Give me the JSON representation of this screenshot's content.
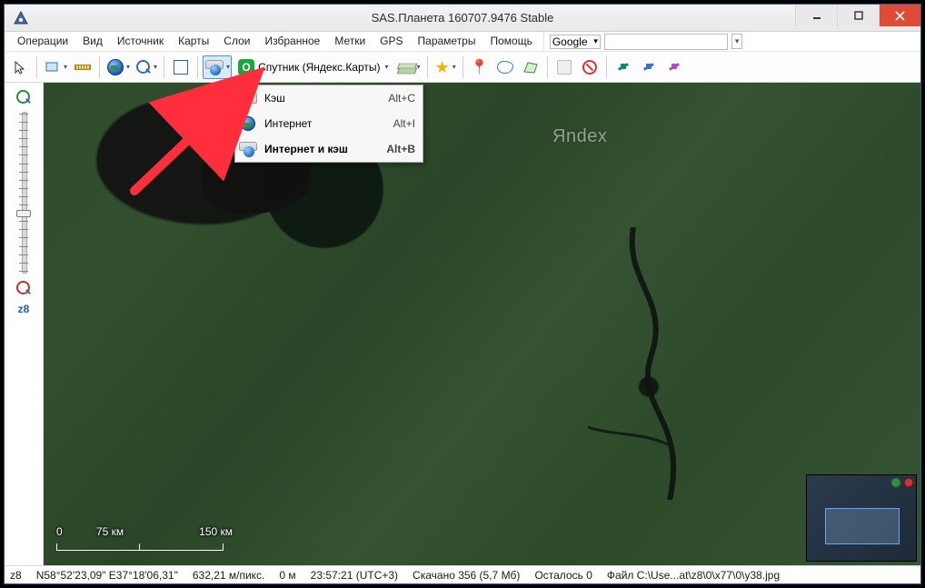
{
  "title": "SAS.Планета 160707.9476 Stable",
  "menubar": [
    "Операции",
    "Вид",
    "Источник",
    "Карты",
    "Слои",
    "Избранное",
    "Метки",
    "GPS",
    "Параметры",
    "Помощь"
  ],
  "search": {
    "provider": "Google",
    "query": ""
  },
  "map_selector": "Спутник (Яндекс.Карты)",
  "source_dropdown": {
    "items": [
      {
        "label": "Кэш",
        "shortcut": "Alt+C",
        "selected": false
      },
      {
        "label": "Интернет",
        "shortcut": "Alt+I",
        "selected": false
      },
      {
        "label": "Интернет и кэш",
        "shortcut": "Alt+B",
        "selected": true
      }
    ]
  },
  "zoom_label": "z8",
  "watermark": "Яndex",
  "scalebar": {
    "l0": "0",
    "l1": "75 км",
    "l2": "150 км"
  },
  "statusbar": {
    "zoom": "z8",
    "coords": "N58°52'23,09\" E37°18'06,31\"",
    "resolution": "632,21 м/пикс.",
    "elev": "0 м",
    "time": "23:57:21 (UTC+3)",
    "downloaded": "Скачано 356 (5,7 Мб)",
    "remaining": "Осталось 0",
    "file": "Файл C:\\Use...at\\z8\\0\\x77\\0\\y38.jpg"
  }
}
